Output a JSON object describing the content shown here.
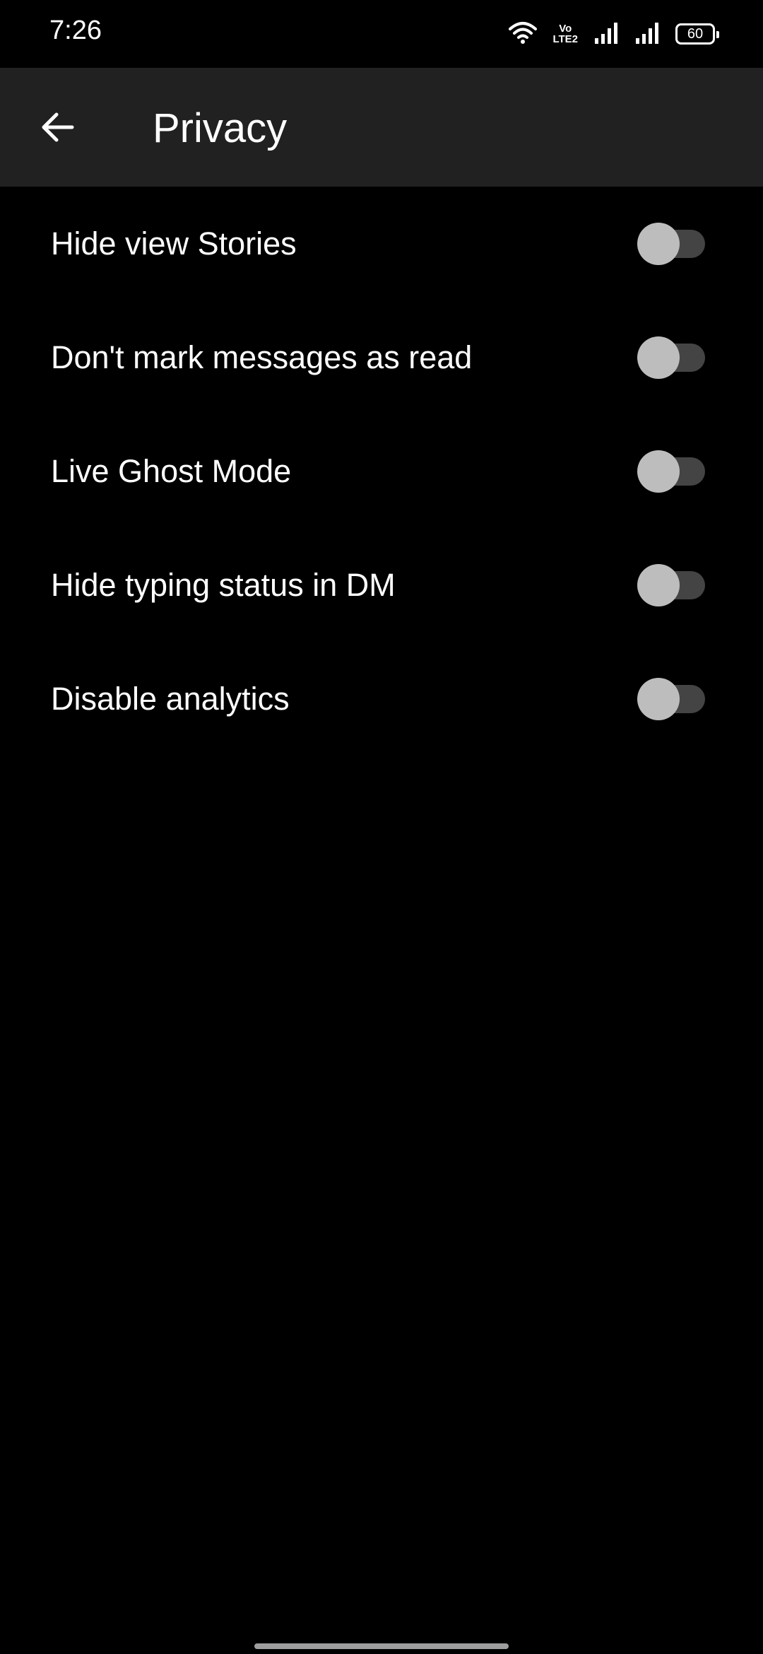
{
  "status_bar": {
    "time": "7:26",
    "volte_line1": "Vo",
    "volte_line2": "LTE2",
    "battery": "60",
    "icons": [
      "wifi-icon",
      "volte-icon",
      "signal-icon",
      "signal-icon",
      "battery-icon"
    ]
  },
  "app_bar": {
    "back_icon": "arrow-back-icon",
    "title": "Privacy"
  },
  "settings": [
    {
      "label": "Hide view Stories",
      "enabled": false
    },
    {
      "label": "Don't mark messages as read",
      "enabled": false
    },
    {
      "label": "Live Ghost Mode",
      "enabled": false
    },
    {
      "label": "Hide typing status in DM",
      "enabled": false
    },
    {
      "label": "Disable analytics",
      "enabled": false
    }
  ],
  "colors": {
    "background": "#000000",
    "app_bar": "#212121",
    "text": "#ffffff",
    "switch_track_off": "#444444",
    "switch_thumb_off": "#bdbdbd"
  }
}
